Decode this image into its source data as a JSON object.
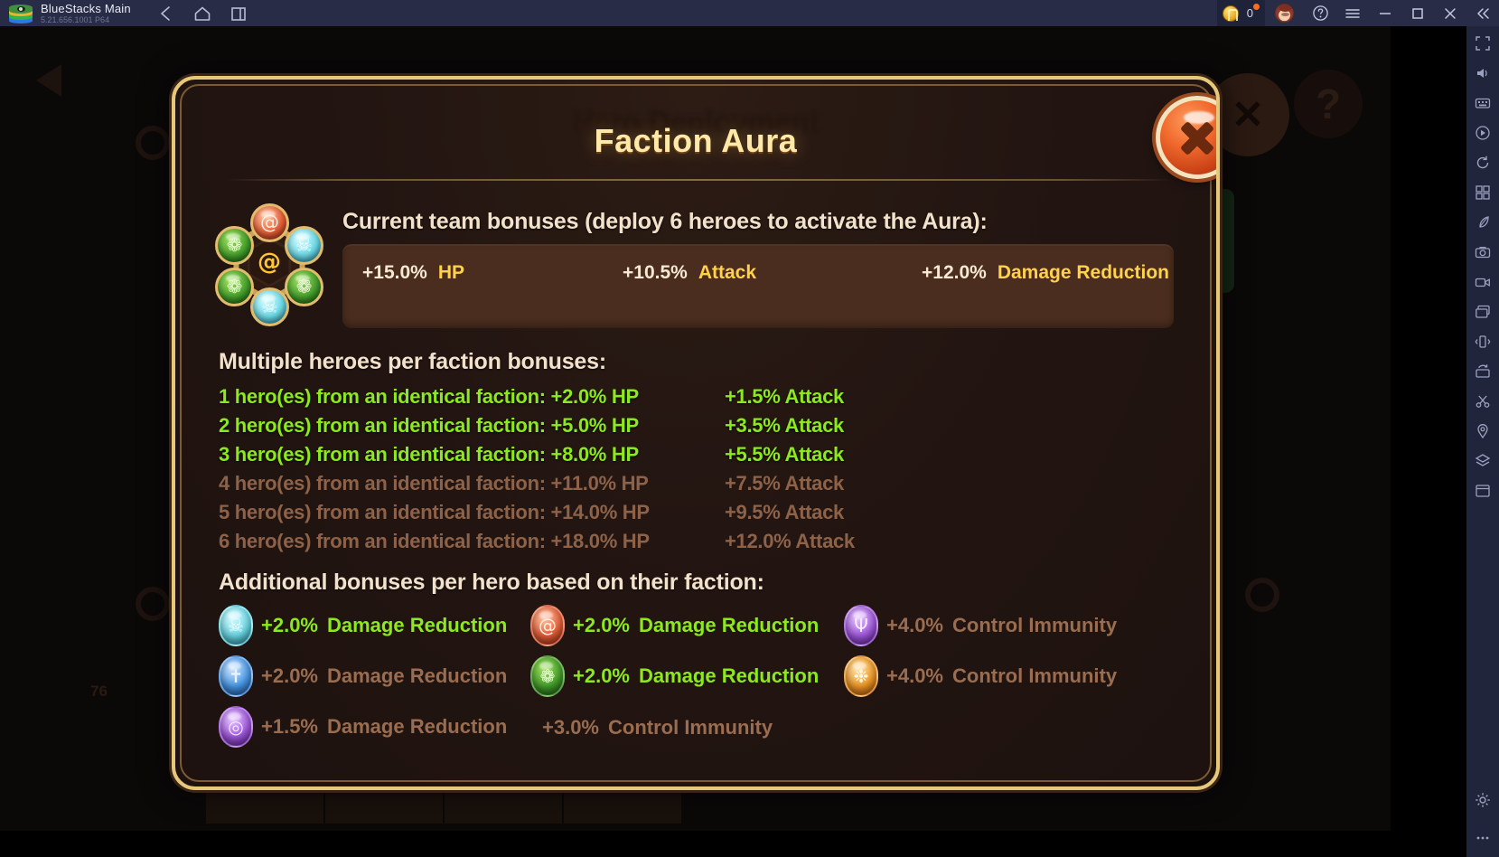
{
  "window": {
    "app_title": "BlueStacks Main",
    "version": "5.21.656.1001  P64",
    "logo_icon": "bluestacks-logo-icon",
    "nav": [
      {
        "name": "back",
        "icon": "arrow-left-icon"
      },
      {
        "name": "home",
        "icon": "home-icon"
      },
      {
        "name": "recents",
        "icon": "multi-window-icon"
      }
    ],
    "coin_count": "0",
    "coin_icon": "coin-icon",
    "notification_dot": true,
    "avatar_icon": "user-avatar-icon",
    "help_icon": "help-circle-icon",
    "menu_icon": "hamburger-menu-icon",
    "minimize_icon": "minimize-icon",
    "maximize_icon": "maximize-icon",
    "close_icon": "close-x-icon",
    "collapse_icon": "double-chevron-left-icon"
  },
  "sidebar": {
    "items": [
      {
        "name": "fullscreen",
        "icon": "fullscreen-icon"
      },
      {
        "name": "volume",
        "icon": "speaker-icon"
      },
      {
        "name": "keymapping",
        "icon": "keyboard-icon"
      },
      {
        "name": "operation-recorder",
        "icon": "play-record-icon"
      },
      {
        "name": "macro-recorder",
        "icon": "rotate-record-icon"
      },
      {
        "name": "multi-instance",
        "icon": "grid-instances-icon"
      },
      {
        "name": "eco-mode",
        "icon": "leaf-eco-icon"
      },
      {
        "name": "screenshot",
        "icon": "camera-icon"
      },
      {
        "name": "screen-record",
        "icon": "video-camera-icon"
      },
      {
        "name": "media-manager",
        "icon": "image-stack-icon"
      },
      {
        "name": "shake",
        "icon": "shake-phone-icon"
      },
      {
        "name": "rotate",
        "icon": "rotate-screen-icon"
      },
      {
        "name": "trim-tool",
        "icon": "scissors-icon"
      },
      {
        "name": "location",
        "icon": "map-pin-icon"
      },
      {
        "name": "layers",
        "icon": "layers-icon"
      },
      {
        "name": "app-center",
        "icon": "app-window-icon"
      },
      {
        "name": "settings",
        "icon": "gear-icon"
      },
      {
        "name": "more",
        "icon": "ellipsis-icon"
      }
    ]
  },
  "game_background": {
    "ghost_title": "Hero Deployment",
    "help_button_glyph": "?",
    "close_button_glyph": "✕",
    "back_arrow_icon": "back-arrow-icon",
    "star_rating_value": "76"
  },
  "modal": {
    "title": "Faction Aura",
    "close_button": {
      "name": "close-modal-button",
      "icon": "close-x-icon"
    },
    "wheel": {
      "name": "faction-aura-wheel",
      "center_icon": "spiral-core-icon",
      "orbs": [
        {
          "name": "orb-top-spiral",
          "faction": "spiral",
          "color": "#e8613a",
          "glyph": "@",
          "cls": "o-red"
        },
        {
          "name": "orb-upper-right-skull",
          "faction": "skull",
          "color": "#6ddbe8",
          "glyph": "☠",
          "cls": "o-cyan"
        },
        {
          "name": "orb-lower-right-leaf",
          "faction": "leaf",
          "color": "#3f9b28",
          "glyph": "❁",
          "cls": "o-green"
        },
        {
          "name": "orb-bottom-skull",
          "faction": "skull",
          "color": "#6ddbe8",
          "glyph": "☠",
          "cls": "o-cyan"
        },
        {
          "name": "orb-lower-left-leaf",
          "faction": "leaf",
          "color": "#3f9b28",
          "glyph": "❁",
          "cls": "o-green"
        },
        {
          "name": "orb-upper-left-leaf",
          "faction": "leaf",
          "color": "#3f9b28",
          "glyph": "❁",
          "cls": "o-green"
        }
      ]
    },
    "current_team_heading": "Current team bonuses (deploy 6 heroes to activate the Aura):",
    "current_team_bonuses": [
      {
        "value": "+15.0%",
        "stat": "HP"
      },
      {
        "value": "+10.5%",
        "stat": "Attack"
      },
      {
        "value": "+12.0%",
        "stat": "Damage Reduction"
      }
    ],
    "multi_heading": "Multiple heroes per faction bonuses:",
    "multi_rows": [
      {
        "label": "1 hero(es) from an identical faction: +2.0%  HP",
        "attack": "+1.5%  Attack",
        "active": true
      },
      {
        "label": "2 hero(es) from an identical faction: +5.0%  HP",
        "attack": "+3.5%  Attack",
        "active": true
      },
      {
        "label": "3 hero(es) from an identical faction: +8.0%  HP",
        "attack": "+5.5%  Attack",
        "active": true
      },
      {
        "label": "4 hero(es) from an identical faction: +11.0%  HP",
        "attack": "+7.5%  Attack",
        "active": false
      },
      {
        "label": "5 hero(es) from an identical faction: +14.0%  HP",
        "attack": "+9.5%  Attack",
        "active": false
      },
      {
        "label": "6 hero(es) from an identical faction: +18.0%  HP",
        "attack": "+12.0%  Attack",
        "active": false
      }
    ],
    "additional_heading": "Additional bonuses per hero based on their faction:",
    "additional_bonuses": [
      {
        "orb": "skull-orb-icon",
        "cls": "o-cyan",
        "glyph": "☠",
        "value": "+2.0%",
        "stat": "Damage Reduction",
        "active": true
      },
      {
        "orb": "spiral-orb-icon",
        "cls": "o-red",
        "glyph": "@",
        "value": "+2.0%",
        "stat": "Damage Reduction",
        "active": true
      },
      {
        "orb": "trident-orb-icon",
        "cls": "o-purple",
        "glyph": "Ψ",
        "value": "+4.0%",
        "stat": "Control Immunity",
        "active": false
      },
      {
        "orb": "cross-orb-icon",
        "cls": "o-blue",
        "glyph": "✝",
        "value": "+2.0%",
        "stat": "Damage Reduction",
        "active": false
      },
      {
        "orb": "leaf-orb-icon",
        "cls": "o-green",
        "glyph": "❁",
        "value": "+2.0%",
        "stat": "Damage Reduction",
        "active": true
      },
      {
        "orb": "flame-orb-icon",
        "cls": "o-orange",
        "glyph": "❉",
        "value": "+4.0%",
        "stat": "Control Immunity",
        "active": false
      },
      {
        "orb": "eye-orb-icon",
        "cls": "o-purple",
        "glyph": "◎",
        "value": "+1.5%",
        "stat": "Damage Reduction",
        "active": false
      },
      {
        "orb": "none",
        "cls": "none",
        "glyph": "",
        "value": "+3.0%",
        "stat": "Control Immunity",
        "active": false
      }
    ]
  },
  "colors": {
    "modal_border": "#e7c878",
    "title_gold": "#ffe9a8",
    "active_green": "#8ce81f",
    "inactive_brown": "#9a6d50",
    "bonus_box": "#4a2d1e",
    "stat_gold": "#ffd24a",
    "heading_cream": "#f2e2cb",
    "titlebar": "#282c46"
  }
}
